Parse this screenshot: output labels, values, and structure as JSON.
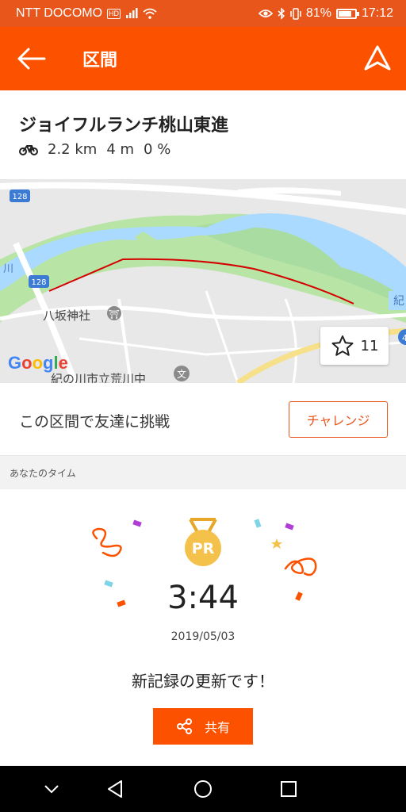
{
  "status_bar": {
    "carrier": "NTT DOCOMO",
    "network_badge": "HD",
    "battery_text": "81%",
    "battery_level": 0.81,
    "time": "17:12",
    "icons": [
      "signal-icon",
      "wifi-icon",
      "eye-icon",
      "bluetooth-icon",
      "vibrate-icon",
      "battery-icon"
    ]
  },
  "app_bar": {
    "title": "区間",
    "back_icon": "arrow-left-icon",
    "nav_icon": "navigation-icon"
  },
  "segment": {
    "name": "ジョイフルランチ桃山東進",
    "sport_icon": "bike-icon",
    "distance": "2.2 km",
    "elevation": "4 m",
    "grade": "0 %"
  },
  "map": {
    "road_shield_1": "128",
    "road_shield_2": "128",
    "label_river": "川",
    "label_kin": "紀",
    "label_shrine": "八坂神社",
    "label_school": "紀の川市立荒川中",
    "school_marker": "文",
    "label_edge": "4",
    "google_logo": "Google",
    "star_count": "11"
  },
  "challenge": {
    "text": "この区間で友達に挑戦",
    "button_label": "チャレンジ"
  },
  "your_time": {
    "section_label": "あなたのタイム",
    "medal_label": "PR",
    "time": "3:44",
    "date": "2019/05/03",
    "message": "新記録の更新です！",
    "share_label": "共有"
  },
  "colors": {
    "brand": "#fc5200",
    "status_bar": "#e8561c",
    "route": "#d40000",
    "medal": "#f4c14a"
  }
}
